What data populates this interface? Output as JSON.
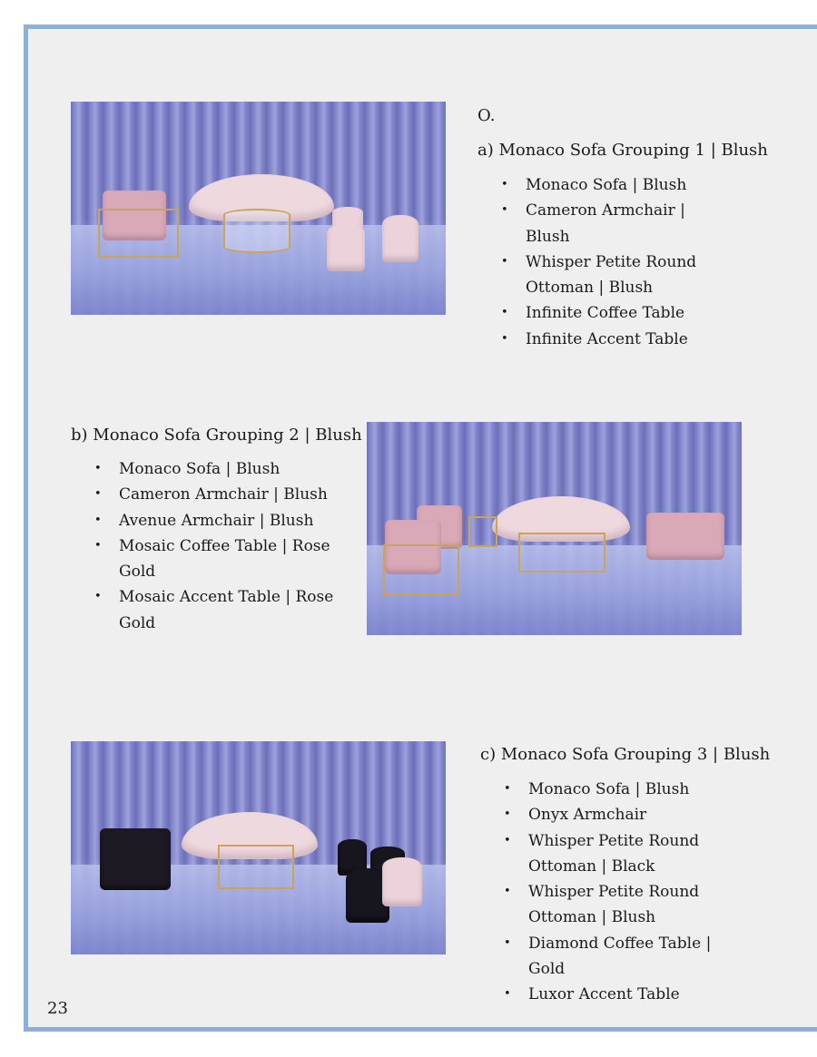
{
  "section_label": "O.",
  "groupings": [
    {
      "title": "a) Monaco Sofa Grouping 1 | Blush",
      "items": [
        "Monaco Sofa | Blush",
        "Cameron Armchair | Blush",
        "Whisper Petite Round Ottoman | Blush",
        "Infinite Coffee Table",
        "Infinite Accent Table"
      ]
    },
    {
      "title": "b) Monaco Sofa Grouping 2 | Blush",
      "items": [
        "Monaco Sofa | Blush",
        "Cameron Armchair | Blush",
        "Avenue Armchair | Blush",
        "Mosaic Coffee Table | Rose Gold",
        "Mosaic Accent Table | Rose Gold"
      ]
    },
    {
      "title": "c) Monaco Sofa Grouping 3 | Blush",
      "items": [
        "Monaco Sofa | Blush",
        "Onyx Armchair",
        "Whisper Petite Round Ottoman | Black",
        "Whisper Petite Round Ottoman | Blush",
        "Diamond Coffee Table | Gold",
        "Luxor Accent Table"
      ]
    }
  ],
  "page_number": "23",
  "colors": {
    "frame_border": "#8fb0d2",
    "page_background": "#efefef",
    "text": "#1a1a1a"
  }
}
